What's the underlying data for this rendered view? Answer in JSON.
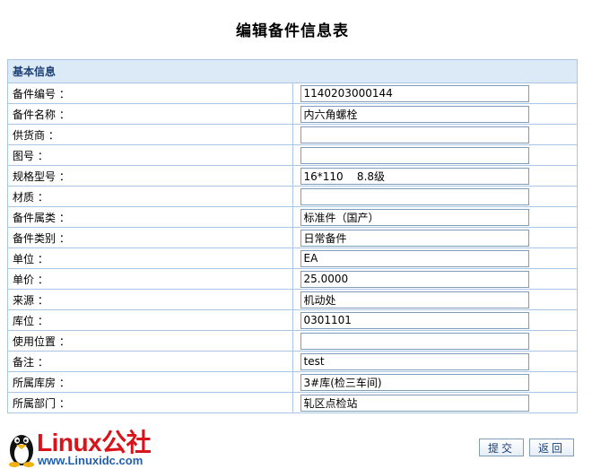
{
  "page": {
    "title": "编辑备件信息表"
  },
  "form": {
    "section_title": "基本信息",
    "fields": [
      {
        "key": "part_no",
        "label": "备件编号 ：",
        "value": "1140203000144"
      },
      {
        "key": "part_name",
        "label": "备件名称 ：",
        "value": "内六角螺栓"
      },
      {
        "key": "supplier",
        "label": "供货商 ：",
        "value": ""
      },
      {
        "key": "drawing_no",
        "label": "图号 ：",
        "value": ""
      },
      {
        "key": "spec_model",
        "label": "规格型号 ：",
        "value": "16*110    8.8级"
      },
      {
        "key": "material",
        "label": "材质 ：",
        "value": ""
      },
      {
        "key": "part_ownership",
        "label": "备件属类 ：",
        "value": "标准件（国产）"
      },
      {
        "key": "part_category",
        "label": "备件类别 ：",
        "value": "日常备件"
      },
      {
        "key": "unit",
        "label": "单位 ：",
        "value": "EA"
      },
      {
        "key": "unit_price",
        "label": "单价 ：",
        "value": "25.0000"
      },
      {
        "key": "source",
        "label": "来源 ：",
        "value": "机动处"
      },
      {
        "key": "location",
        "label": "库位 ：",
        "value": "0301101"
      },
      {
        "key": "usage_location",
        "label": "使用位置 ：",
        "value": ""
      },
      {
        "key": "remarks",
        "label": "备注 ：",
        "value": "test"
      },
      {
        "key": "warehouse",
        "label": "所属库房 ：",
        "value": "3#库(检三车间)"
      },
      {
        "key": "department",
        "label": "所属部门 ：",
        "value": "轧区点检站"
      }
    ]
  },
  "buttons": {
    "submit_label": "提交",
    "back_label": "返回"
  },
  "watermark": {
    "brand": "Linux公社",
    "url": "www.Linuxidc.com"
  },
  "colors": {
    "section_bg": "#dce9f7",
    "border": "#a9c7e4",
    "input_border": "#7f9db9",
    "logo_red": "#d9131a",
    "logo_blue": "#1f5fb0"
  }
}
